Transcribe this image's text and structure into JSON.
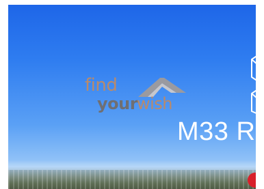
{
  "logo": {
    "find": "find",
    "your": "your",
    "wish": "wish"
  },
  "banner": {
    "title": "M33 R"
  },
  "icons": {
    "house_roof": "roof-icon",
    "deco_outline": "outline-shape-icon"
  },
  "colors": {
    "sky_top": "#1e66e8",
    "sky_bottom": "#a9cff6",
    "logo_accent": "#b98a6b",
    "logo_gray": "#6f6f73",
    "title_text": "#ffffff",
    "red_mark": "#d8202a"
  }
}
